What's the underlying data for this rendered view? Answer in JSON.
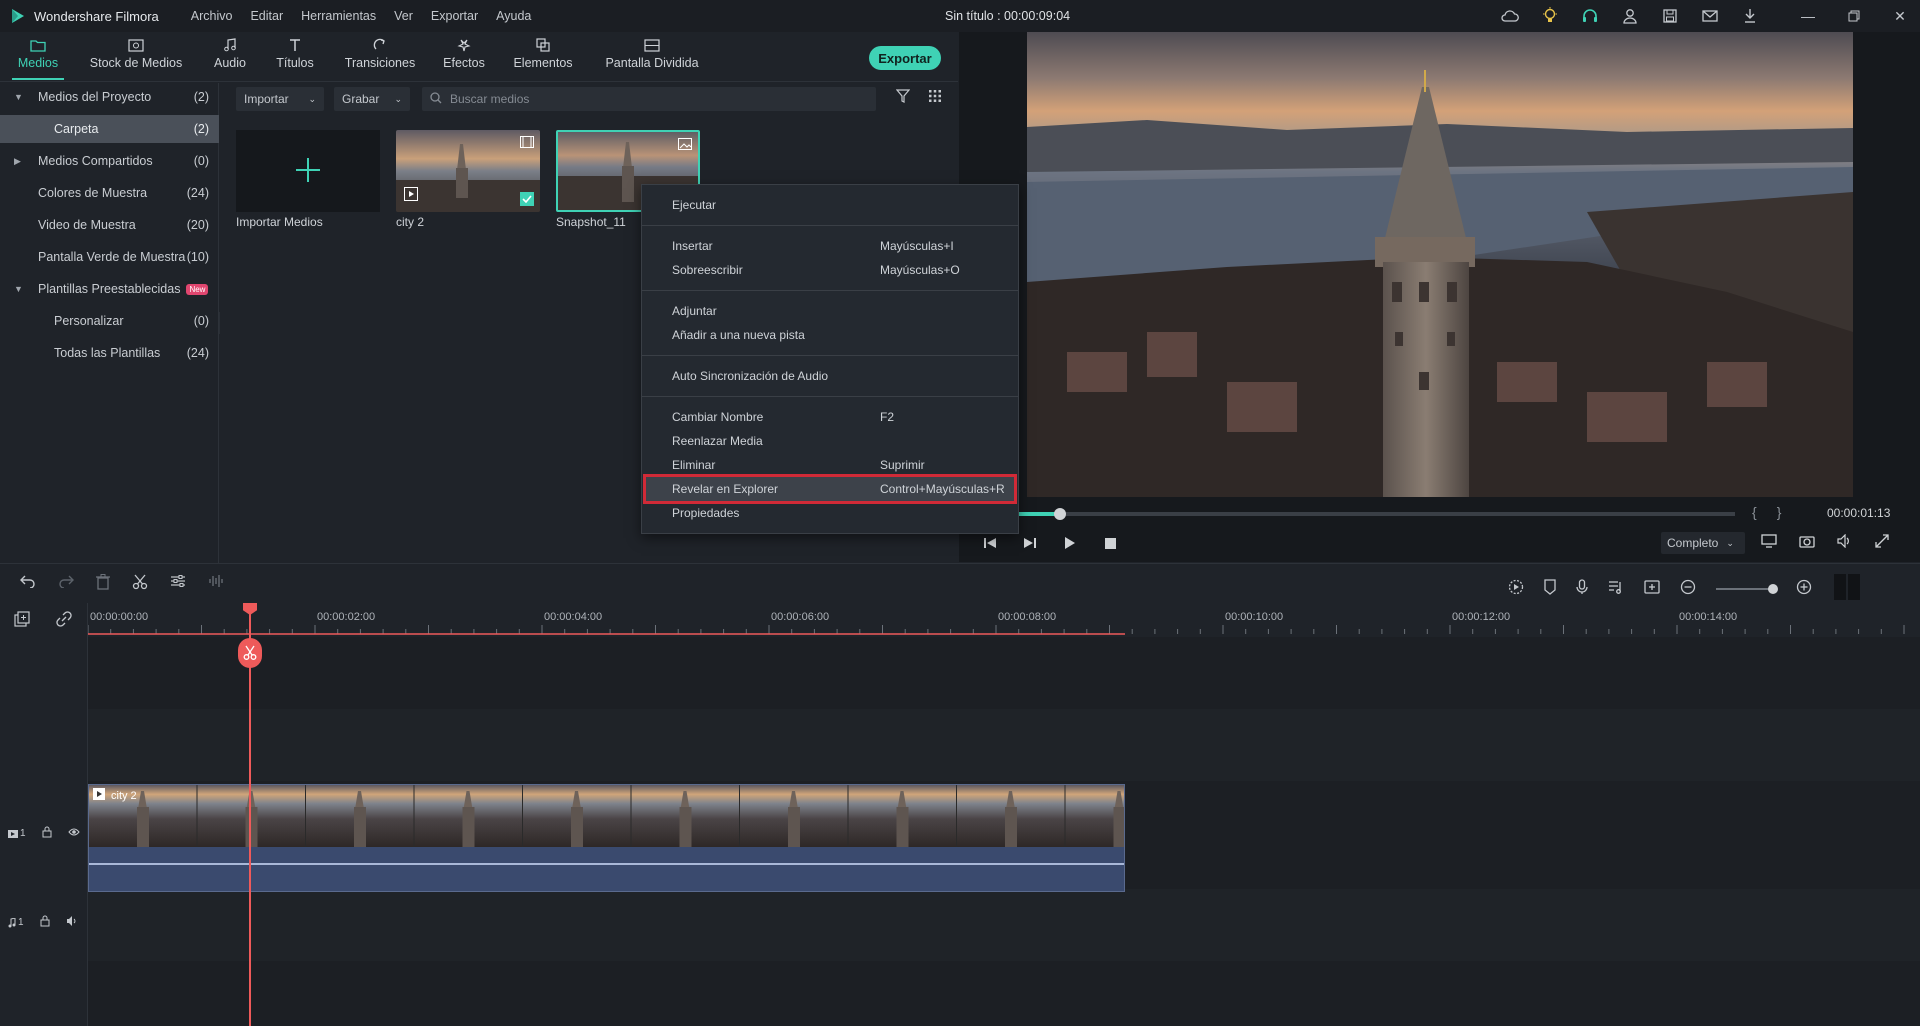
{
  "app": {
    "name": "Wondershare Filmora",
    "doc_title": "Sin título : 00:00:09:04",
    "menu": [
      "Archivo",
      "Editar",
      "Herramientas",
      "Ver",
      "Exportar",
      "Ayuda"
    ]
  },
  "tabs": [
    {
      "label": "Medios",
      "icon": "folder-icon",
      "active": true
    },
    {
      "label": "Stock de Medios",
      "icon": "stock-media-icon"
    },
    {
      "label": "Audio",
      "icon": "music-note-icon"
    },
    {
      "label": "Títulos",
      "icon": "text-icon"
    },
    {
      "label": "Transiciones",
      "icon": "transition-icon"
    },
    {
      "label": "Efectos",
      "icon": "effects-icon"
    },
    {
      "label": "Elementos",
      "icon": "elements-icon"
    },
    {
      "label": "Pantalla Dividida",
      "icon": "split-screen-icon"
    }
  ],
  "export_label": "Exportar",
  "sidebar": {
    "items": [
      {
        "name": "Medios del Proyecto",
        "count": "(2)"
      },
      {
        "name": "Carpeta",
        "count": "(2)"
      },
      {
        "name": "Medios Compartidos",
        "count": "(0)"
      },
      {
        "name": "Colores de Muestra",
        "count": "(24)"
      },
      {
        "name": "Video de Muestra",
        "count": "(20)"
      },
      {
        "name": "Pantalla Verde de Muestra",
        "count": "(10)"
      },
      {
        "name": "Plantillas Preestablecidas",
        "count": "",
        "badge": "New"
      },
      {
        "name": "Personalizar",
        "count": "(0)"
      },
      {
        "name": "Todas las Plantillas",
        "count": "(24)"
      }
    ]
  },
  "media": {
    "import_dropdown": "Importar",
    "record_dropdown": "Grabar",
    "search_placeholder": "Buscar medios",
    "items": [
      {
        "label": "Importar Medios"
      },
      {
        "label": "city 2"
      },
      {
        "label": "Snapshot_11"
      }
    ]
  },
  "context_menu": {
    "items": [
      {
        "label": "Ejecutar",
        "shortcut": ""
      },
      {
        "label": "Insertar",
        "shortcut": "Mayúsculas+I"
      },
      {
        "label": "Sobreescribir",
        "shortcut": "Mayúsculas+O"
      },
      {
        "label": "Adjuntar",
        "shortcut": ""
      },
      {
        "label": "Añadir a una nueva pista",
        "shortcut": ""
      },
      {
        "label": "Auto Sincronización de Audio",
        "shortcut": ""
      },
      {
        "label": "Cambiar Nombre",
        "shortcut": "F2"
      },
      {
        "label": "Reenlazar Media",
        "shortcut": ""
      },
      {
        "label": "Eliminar",
        "shortcut": "Suprimir"
      },
      {
        "label": "Revelar en Explorer",
        "shortcut": "Control+Mayúsculas+R",
        "highlighted": true
      },
      {
        "label": "Propiedades",
        "shortcut": ""
      }
    ]
  },
  "preview": {
    "timecode": "00:00:01:13",
    "progress": 0.13,
    "quality": "Completo",
    "braces": [
      "{",
      "}"
    ]
  },
  "timeline": {
    "ruler": [
      "00:00:00:00",
      "00:00:02:00",
      "00:00:04:00",
      "00:00:06:00",
      "00:00:08:00",
      "00:00:10:00",
      "00:00:12:00",
      "00:00:14:00"
    ],
    "clip_name": "city 2",
    "video_track": "1",
    "audio_track": "1"
  },
  "colors": {
    "accent": "#3fd2b5",
    "playhead": "#ee5a5a",
    "highlight_border": "#d12a37",
    "background": "#1f2329"
  }
}
